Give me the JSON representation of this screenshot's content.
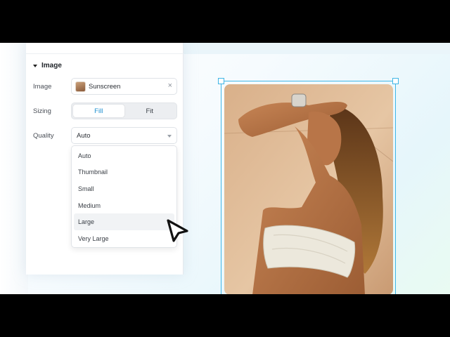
{
  "panel": {
    "section_title": "Image",
    "image_label": "Image",
    "image_value": "Sunscreen",
    "clear_icon": "×",
    "sizing_label": "Sizing",
    "sizing_options": [
      "Fill",
      "Fit"
    ],
    "sizing_selected": "Fill",
    "quality_label": "Quality",
    "quality_value": "Auto"
  },
  "dropdown": {
    "options": [
      "Auto",
      "Thumbnail",
      "Small",
      "Medium",
      "Large",
      "Very Large"
    ],
    "hovered": "Large"
  },
  "canvas": {
    "selected_element": "image-frame",
    "accent_color": "#3fb6e6"
  },
  "icons": {
    "section_caret": "caret-down-icon",
    "thumbnail": "image-thumbnail-icon",
    "clear": "close-icon",
    "quality_caret": "chevron-down-icon",
    "cursor": "pointer-cursor-icon"
  },
  "colors": {
    "accent": "#1c8fd0",
    "selection": "#3fb6e6"
  }
}
